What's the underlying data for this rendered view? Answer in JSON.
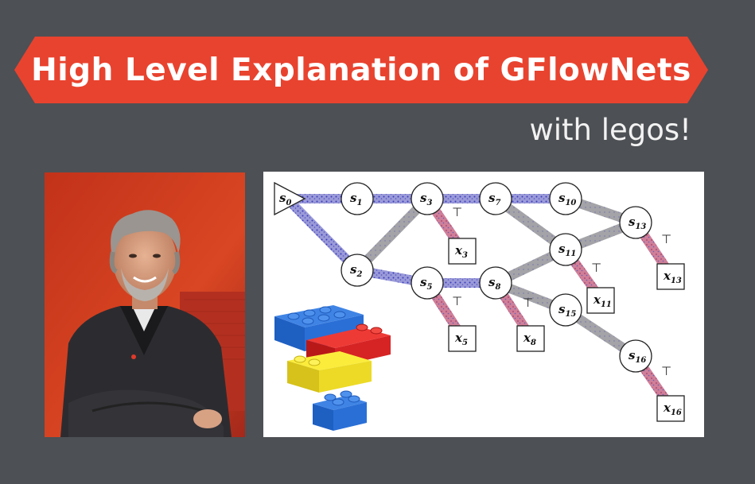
{
  "title": "High Level Explanation of GFlowNets",
  "subtitle": "with legos!",
  "photo": {
    "alt": "Portrait of a man in a dark blazer with arms crossed in front of a red background"
  },
  "diagram": {
    "nodes": [
      {
        "id": "s0",
        "base": "s",
        "sub": "0",
        "shape": "triangle"
      },
      {
        "id": "s1",
        "base": "s",
        "sub": "1",
        "shape": "circle"
      },
      {
        "id": "s2",
        "base": "s",
        "sub": "2",
        "shape": "circle"
      },
      {
        "id": "s3",
        "base": "s",
        "sub": "3",
        "shape": "circle"
      },
      {
        "id": "s5",
        "base": "s",
        "sub": "5",
        "shape": "circle"
      },
      {
        "id": "s7",
        "base": "s",
        "sub": "7",
        "shape": "circle"
      },
      {
        "id": "s8",
        "base": "s",
        "sub": "8",
        "shape": "circle"
      },
      {
        "id": "s10",
        "base": "s",
        "sub": "10",
        "shape": "circle"
      },
      {
        "id": "s11",
        "base": "s",
        "sub": "11",
        "shape": "circle"
      },
      {
        "id": "s13",
        "base": "s",
        "sub": "13",
        "shape": "circle"
      },
      {
        "id": "s15",
        "base": "s",
        "sub": "15",
        "shape": "circle"
      },
      {
        "id": "s16",
        "base": "s",
        "sub": "16",
        "shape": "circle"
      },
      {
        "id": "x3",
        "base": "x",
        "sub": "3",
        "shape": "square"
      },
      {
        "id": "x5",
        "base": "x",
        "sub": "5",
        "shape": "square"
      },
      {
        "id": "x8",
        "base": "x",
        "sub": "8",
        "shape": "square"
      },
      {
        "id": "x11",
        "base": "x",
        "sub": "11",
        "shape": "square"
      },
      {
        "id": "x13",
        "base": "x",
        "sub": "13",
        "shape": "square"
      },
      {
        "id": "x16",
        "base": "x",
        "sub": "16",
        "shape": "square"
      }
    ],
    "terminal_symbol": "⊤",
    "colors": {
      "blue_edge": "#7b7fd0",
      "gray_edge": "#a0a0a4",
      "red_edge": "#c8708a",
      "node_stroke": "#222222"
    }
  },
  "legos": [
    {
      "color": "#1e63c8",
      "name": "blue-brick"
    },
    {
      "color": "#d81f1f",
      "name": "red-brick"
    },
    {
      "color": "#f2e227",
      "name": "yellow-brick"
    },
    {
      "color": "#1e63c8",
      "name": "small-blue-brick"
    }
  ]
}
